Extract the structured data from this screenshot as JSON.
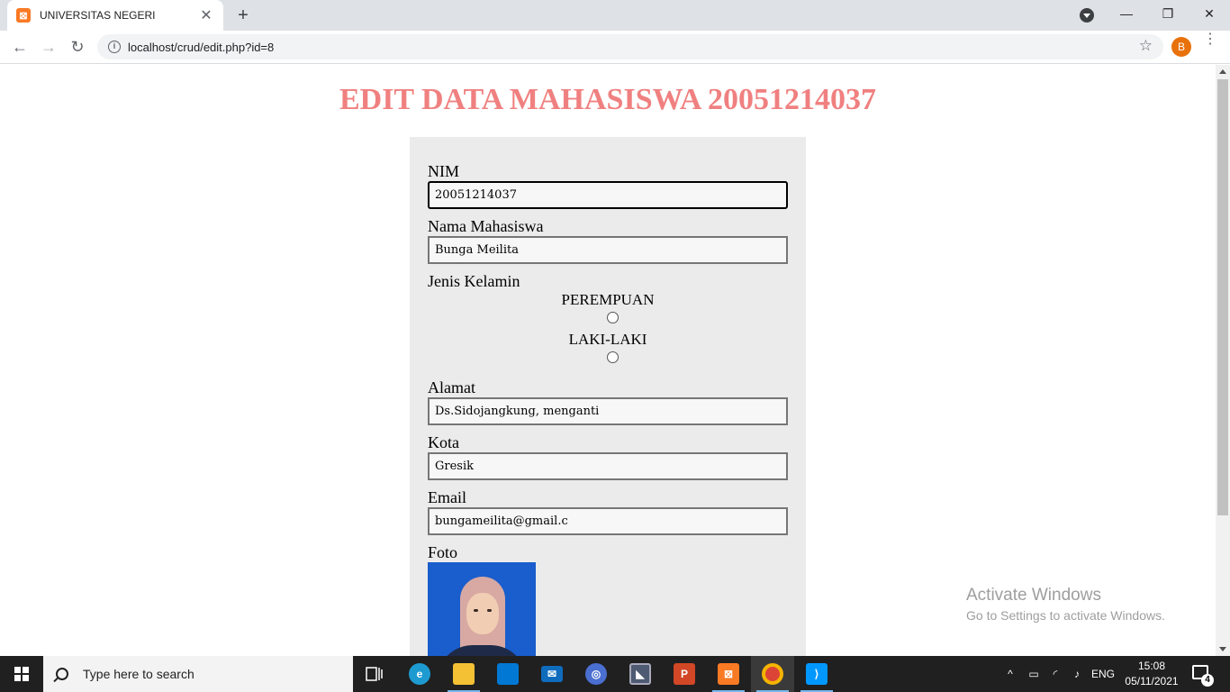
{
  "browser": {
    "tab_title": "UNIVERSITAS NEGERI",
    "tab_close": "✕",
    "new_tab": "+",
    "url": "localhost/crud/edit.php?id=8",
    "profile_initial": "B",
    "window_controls": {
      "minimize": "—",
      "restore": "❐",
      "close": "✕"
    },
    "nav": {
      "back": "←",
      "forward": "→",
      "reload": "↻",
      "star": "☆",
      "menu": "⋮"
    }
  },
  "page": {
    "heading": "EDIT DATA MAHASISWA 20051214037",
    "form": {
      "nim_label": "NIM",
      "nim_value": "20051214037",
      "nama_label": "Nama Mahasiswa",
      "nama_value": "Bunga Meilita",
      "gender_label": "Jenis Kelamin",
      "gender_options": [
        "PEREMPUAN",
        "LAKI-LAKI"
      ],
      "alamat_label": "Alamat",
      "alamat_value": "Ds.Sidojangkung, menganti",
      "kota_label": "Kota",
      "kota_value": "Gresik",
      "email_label": "Email",
      "email_value": "bungameilita@gmail.c",
      "foto_label": "Foto"
    }
  },
  "watermark": {
    "line1": "Activate Windows",
    "line2": "Go to Settings to activate Windows."
  },
  "taskbar": {
    "search_placeholder": "Type here to search",
    "language": "ENG",
    "time": "15:08",
    "date": "05/11/2021",
    "notification_count": "4",
    "colors": {
      "edge": "#1d9bd1",
      "explorer": "#f4c034",
      "store": "#0078d4",
      "mail": "#0f6cbd",
      "powerpoint": "#d24726",
      "xampp": "#fb7a24",
      "chrome": "#db4437",
      "vscode": "#0098ff"
    }
  }
}
